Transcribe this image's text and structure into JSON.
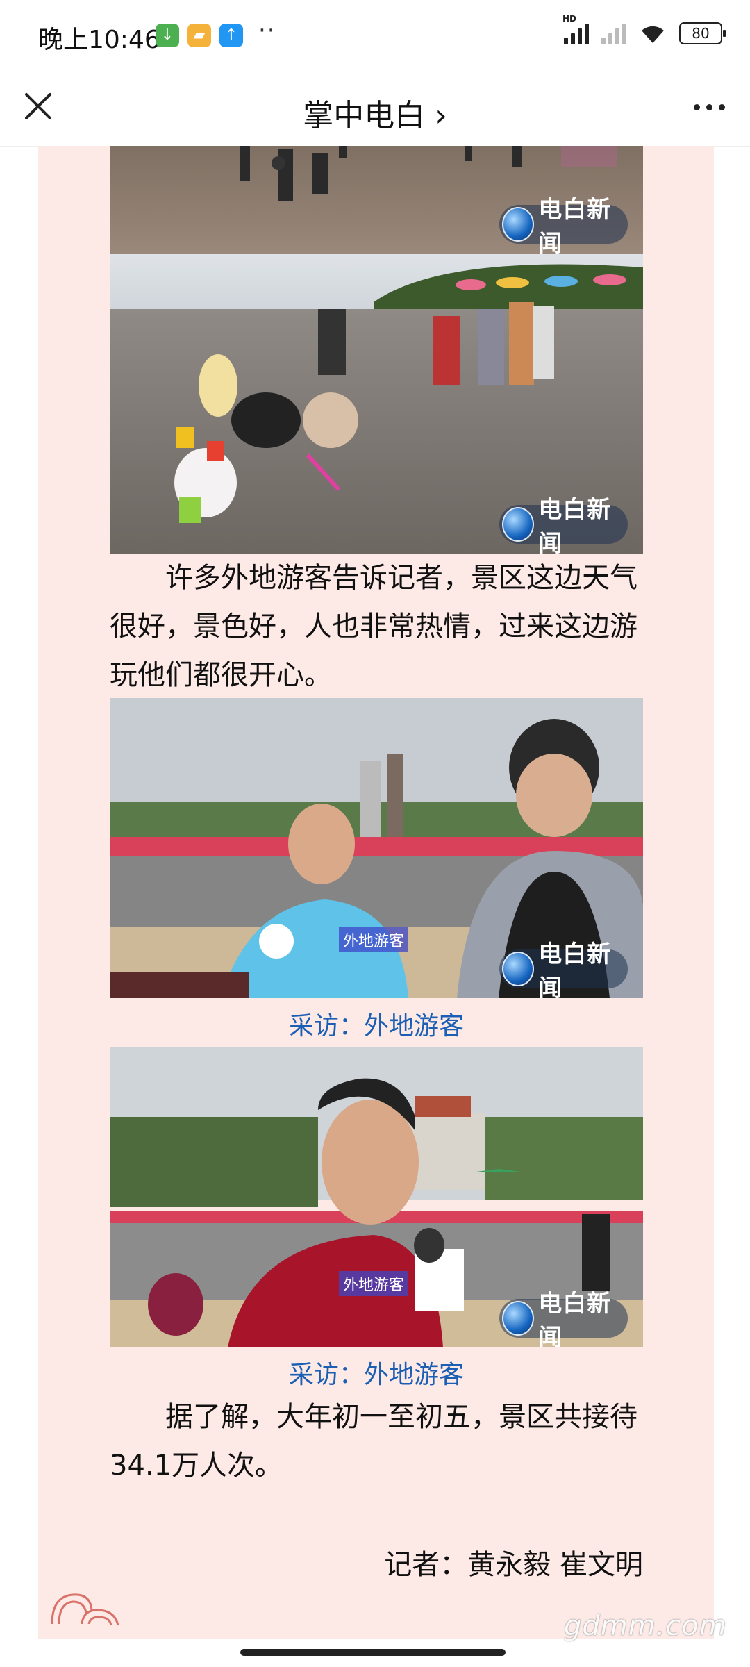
{
  "status_bar": {
    "time": "晚上10:46",
    "more_icon": "··",
    "hd_label": "HD",
    "battery": "80",
    "colors": {
      "notif_green": "#4caf50",
      "notif_orange": "#f5b23a",
      "notif_blue": "#2196f3"
    }
  },
  "nav": {
    "title": "掌中电白 ›",
    "close_icon": "close-icon",
    "more_icon": "more-dots-icon"
  },
  "article": {
    "background": "#fde9e6",
    "logo_text": "电白新闻",
    "paragraph1": "许多外地游客告诉记者，景区这边天气很好，景色好，人也非常热情，过来这边游玩他们都很开心。",
    "photo3_tag": "外地游客",
    "caption1": "采访：外地游客",
    "photo4_tag": "外地游客",
    "caption2": "采访：外地游客",
    "paragraph2": "据了解，大年初一至初五，景区共接待34.1万人次。",
    "author": "记者：黄永毅  崔文明"
  },
  "watermark": "gdmm.com"
}
